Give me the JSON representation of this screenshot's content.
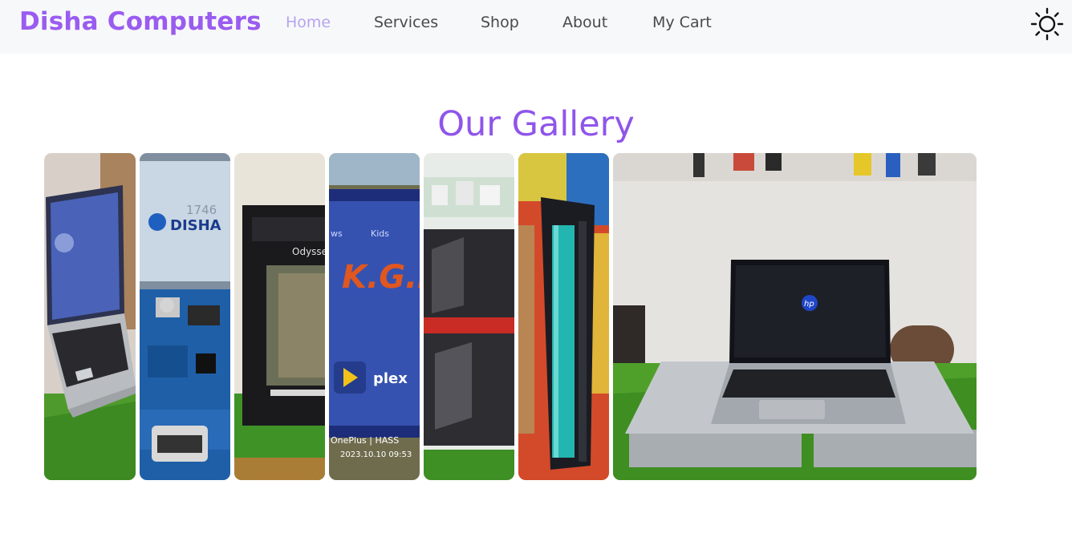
{
  "navbar": {
    "brand": "Disha Computers",
    "links": [
      "Home",
      "Services",
      "Shop",
      "About",
      "My Cart"
    ],
    "active_index": 0,
    "theme_icon": "sun-icon"
  },
  "gallery": {
    "title": "Our Gallery",
    "photo_texts": {
      "disha_logo": "DISHA",
      "odyssey": "Odyssey",
      "tv_menu": [
        "ws",
        "Kids"
      ],
      "kgf": "K.G.F",
      "plex": "plex",
      "watermark": "OnePlus | HASS",
      "watermark_date": "2023.10.10 09:53",
      "hp_logo": "hp",
      "clock": "1746"
    }
  },
  "colors": {
    "brand": "#9a5cf0",
    "active_link": "#b7a4ef",
    "title": "#8f55ea",
    "navbar_bg": "#f7f8fa"
  }
}
